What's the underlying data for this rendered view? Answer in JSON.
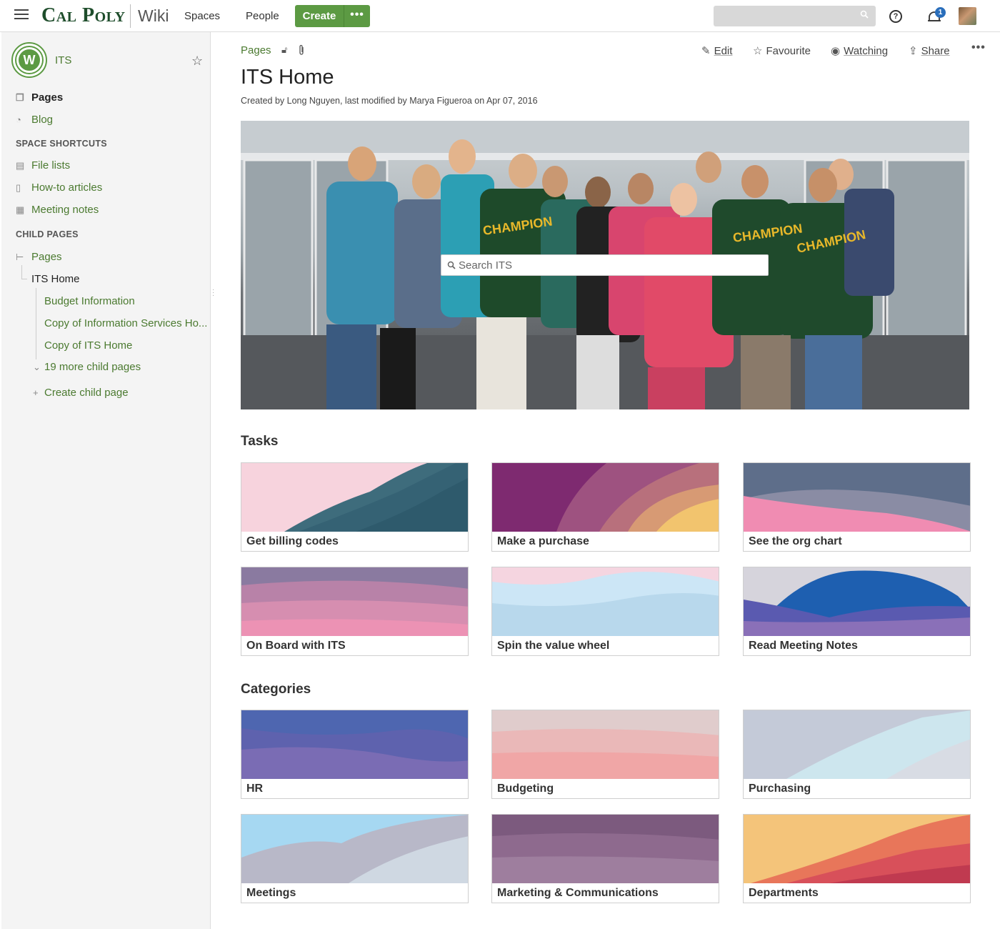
{
  "topbar": {
    "logo": "Cal Poly",
    "app": "Wiki",
    "nav": [
      "Spaces",
      "People"
    ],
    "create_label": "Create",
    "more_label": "•••",
    "help_label": "?",
    "notification_count": "1"
  },
  "sidebar": {
    "space_name": "ITS",
    "logo_letter": "W",
    "pages_label": "Pages",
    "blog_label": "Blog",
    "space_shortcuts_heading": "SPACE SHORTCUTS",
    "shortcuts": [
      "File lists",
      "How-to articles",
      "Meeting notes"
    ],
    "child_pages_heading": "CHILD PAGES",
    "tree_root": "Pages",
    "tree_current": "ITS Home",
    "tree_children": [
      "Budget Information",
      "Copy of Information Services Ho...",
      "Copy of ITS Home"
    ],
    "more_children": "19 more child pages",
    "create_child": "Create child page"
  },
  "content": {
    "breadcrumb": "Pages",
    "actions": {
      "edit": "Edit",
      "favourite": "Favourite",
      "watching": "Watching",
      "share": "Share"
    },
    "title": "ITS Home",
    "byline": "Created by Long Nguyen, last modified by Marya Figueroa on Apr 07, 2016",
    "hero_search_placeholder": "Search ITS",
    "tasks_heading": "Tasks",
    "tasks": [
      {
        "label": "Get billing codes"
      },
      {
        "label": "Make a purchase"
      },
      {
        "label": "See the org chart"
      },
      {
        "label": "On Board with ITS"
      },
      {
        "label": "Spin the value wheel"
      },
      {
        "label": "Read Meeting Notes"
      }
    ],
    "categories_heading": "Categories",
    "categories": [
      {
        "label": "HR"
      },
      {
        "label": "Budgeting"
      },
      {
        "label": "Purchasing"
      },
      {
        "label": "Meetings"
      },
      {
        "label": "Marketing & Communications"
      },
      {
        "label": "Departments"
      }
    ]
  },
  "colors": {
    "brand_green": "#1e4d2b",
    "accent_green": "#5c9a43",
    "link_green": "#4b7a30",
    "badge_blue": "#2a6ebb"
  }
}
